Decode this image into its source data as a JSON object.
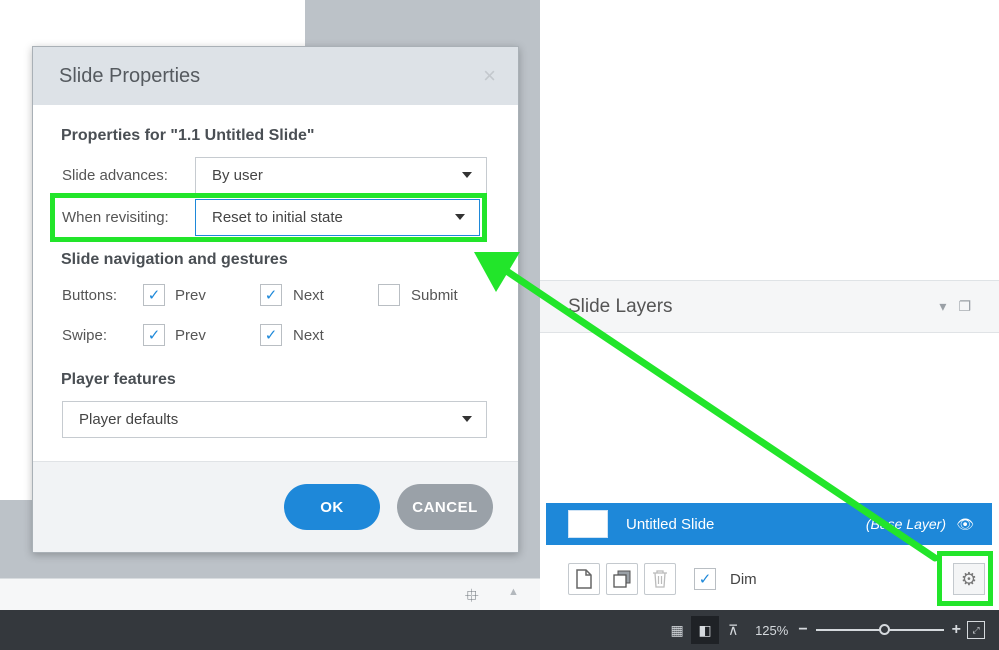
{
  "dialog": {
    "title": "Slide Properties",
    "properties_heading": "Properties for \"1.1 Untitled Slide\"",
    "slide_advances_label": "Slide advances:",
    "slide_advances_value": "By user",
    "when_revisiting_label": "When revisiting:",
    "when_revisiting_value": "Reset to initial state",
    "nav_heading": "Slide navigation and gestures",
    "buttons_label": "Buttons:",
    "swipe_label": "Swipe:",
    "prev_label": "Prev",
    "next_label": "Next",
    "submit_label": "Submit",
    "buttons_prev_checked": true,
    "buttons_next_checked": true,
    "buttons_submit_checked": false,
    "swipe_prev_checked": true,
    "swipe_next_checked": true,
    "player_heading": "Player features",
    "player_value": "Player defaults",
    "ok_label": "OK",
    "cancel_label": "CANCEL",
    "close_glyph": "×",
    "check_glyph": "✓"
  },
  "layers": {
    "title": "Slide Layers",
    "base_layer_name": "Untitled Slide",
    "base_layer_type": "(Base Layer)",
    "dim_label": "Dim",
    "dim_checked": true
  },
  "status": {
    "zoom": "125%"
  },
  "icons": {
    "close": "close-icon",
    "gear": "gear-icon",
    "eye": "eye-icon",
    "new_layer": "new-layer-icon",
    "duplicate_layer": "duplicate-layer-icon",
    "delete_layer": "trash-icon",
    "slide_sorter": "grid-view-icon",
    "normal_view": "normal-view-icon",
    "presentation": "presentation-icon",
    "fit": "fit-to-window-icon"
  },
  "colors": {
    "accent": "#1e88d9",
    "highlight": "#22e52a",
    "status_bar": "#34383d",
    "cancel_button": "#9aa1a8"
  }
}
